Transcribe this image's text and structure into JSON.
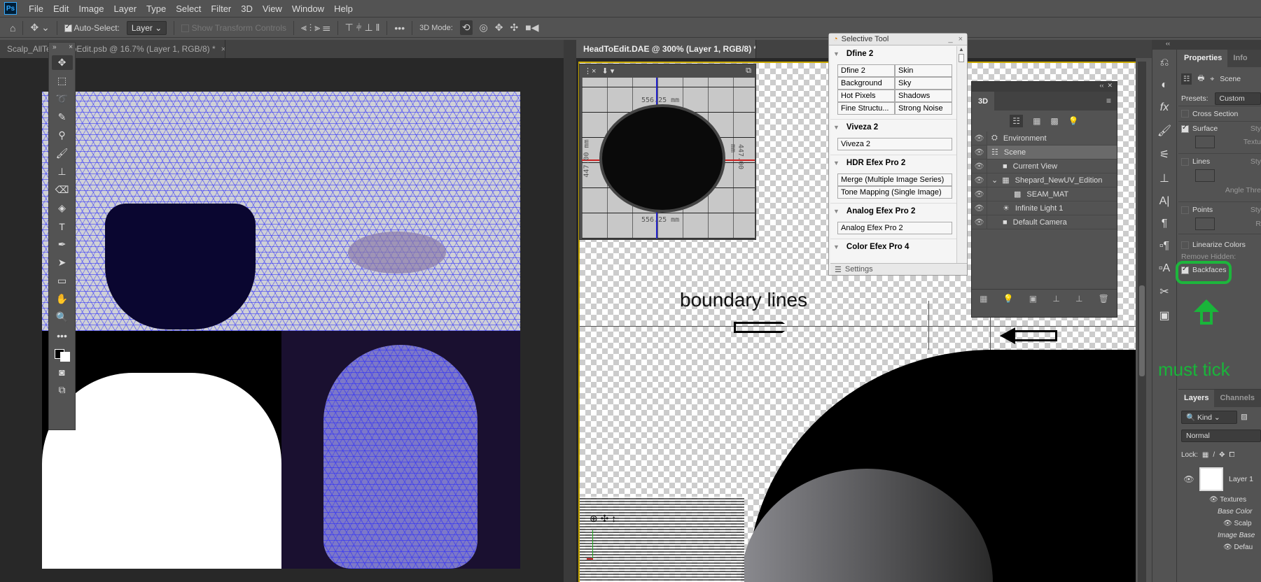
{
  "menu": [
    "File",
    "Edit",
    "Image",
    "Layer",
    "Type",
    "Select",
    "Filter",
    "3D",
    "View",
    "Window",
    "Help"
  ],
  "options": {
    "auto_select_label": "Auto-Select:",
    "auto_select_value": "Layer",
    "show_transform": "Show Transform Controls",
    "mode_3d_label": "3D Mode:"
  },
  "documents": [
    {
      "title": "Scalp_AllTe",
      "title_suffix": "oEdit.psb @ 16.7% (Layer 1, RGB/8) *"
    },
    {
      "title": "HeadToEdit.DAE @ 300% (Layer 1, RGB/8) *"
    }
  ],
  "inset_view": {
    "width_label": "556.25 mm",
    "height_label": "447.00 mm"
  },
  "selective_tool": {
    "title": "Selective Tool",
    "sections": [
      {
        "name": "Dfine 2",
        "buttons": [
          [
            "Dfine 2",
            "Skin"
          ],
          [
            "Background",
            "Sky"
          ],
          [
            "Hot Pixels",
            "Shadows"
          ],
          [
            "Fine Structu...",
            "Strong Noise"
          ]
        ]
      },
      {
        "name": "Viveza 2",
        "buttons": [
          [
            "Viveza 2"
          ]
        ]
      },
      {
        "name": "HDR Efex Pro 2",
        "buttons": [
          [
            "Merge (Multiple Image Series)"
          ],
          [
            "Tone Mapping (Single Image)"
          ]
        ]
      },
      {
        "name": "Analog Efex Pro 2",
        "buttons": [
          [
            "Analog Efex Pro 2"
          ]
        ]
      },
      {
        "name": "Color Efex Pro 4",
        "buttons": []
      }
    ],
    "footer": "Settings"
  },
  "panel_3d": {
    "tab": "3D",
    "items": [
      {
        "label": "Environment",
        "indent": 0,
        "icon": "environment-icon"
      },
      {
        "label": "Scene",
        "indent": 0,
        "icon": "scene-icon",
        "selected": true
      },
      {
        "label": "Current View",
        "indent": 1,
        "icon": "camera-icon"
      },
      {
        "label": "Shepard_NewUV_Edition",
        "indent": 1,
        "icon": "mesh-icon",
        "expanded": true
      },
      {
        "label": "SEAM_MAT",
        "indent": 2,
        "icon": "material-icon"
      },
      {
        "label": "Infinite Light 1",
        "indent": 1,
        "icon": "light-icon"
      },
      {
        "label": "Default Camera",
        "indent": 1,
        "icon": "camera-icon"
      }
    ]
  },
  "properties": {
    "tabs": [
      "Properties",
      "Info"
    ],
    "mode": "Scene",
    "presets_label": "Presets:",
    "presets_value": "Custom",
    "cross_section": "Cross Section",
    "surface": "Surface",
    "surface_style": "Sty",
    "surface_texture": "Textu",
    "lines": "Lines",
    "lines_style": "Sty",
    "angle": "Angle Thre",
    "points": "Points",
    "points_style": "Sty",
    "points_r": "R",
    "linearize": "Linearize Colors",
    "remove_hidden": "Remove Hidden:",
    "backfaces": "Backfaces"
  },
  "layers": {
    "tabs": [
      "Layers",
      "Channels"
    ],
    "filter": "Kind",
    "blend": "Normal",
    "lock_label": "Lock:",
    "layer_name": "Layer 1",
    "sub": [
      "Textures",
      "Base Color",
      "Scalp",
      "Image Base",
      "Defau"
    ]
  },
  "annotations": {
    "boundary": "boundary lines",
    "must_tick": "must tick",
    "color": "#19b53a"
  }
}
